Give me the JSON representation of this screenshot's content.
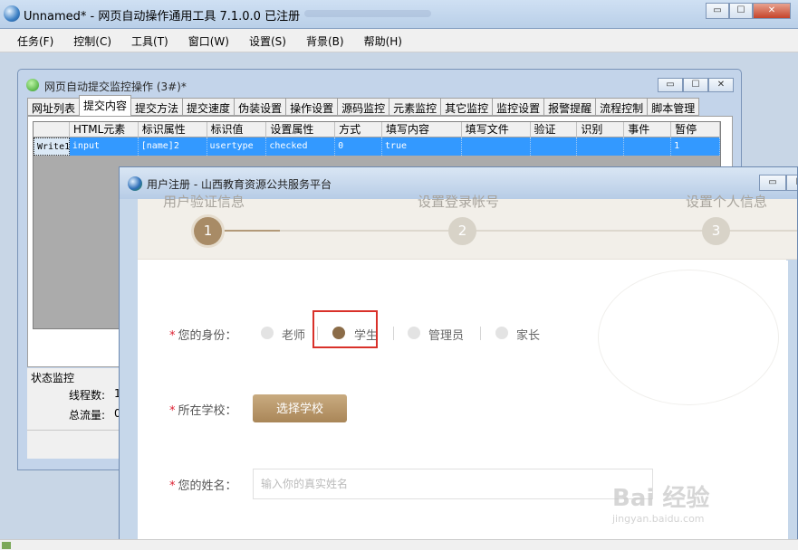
{
  "main_window": {
    "title": "Unnamed* - 网页自动操作通用工具 7.1.0.0  已注册",
    "buttons": [
      "▭",
      "☐",
      "✕"
    ]
  },
  "menu": [
    "任务(F)",
    "控制(C)",
    "工具(T)",
    "窗口(W)",
    "设置(S)",
    "背景(B)",
    "帮助(H)"
  ],
  "monitor_window": {
    "title": "网页自动提交监控操作  (3#)*",
    "buttons": [
      "▭",
      "☐",
      "✕"
    ],
    "tabs": [
      "网址列表",
      "提交内容",
      "提交方法",
      "提交速度",
      "伪装设置",
      "操作设置",
      "源码监控",
      "元素监控",
      "其它监控",
      "监控设置",
      "报警提醒",
      "流程控制",
      "脚本管理"
    ],
    "active_tab": "提交内容",
    "grid_headers": [
      "",
      "HTML元素",
      "标识属性",
      "标识值",
      "设置属性",
      "方式",
      "填写内容",
      "填写文件",
      "验证",
      "识别",
      "事件",
      "暂停"
    ],
    "grid_rows": [
      [
        "Write1",
        "input",
        "[name]2",
        "usertype",
        "checked",
        "0",
        "true",
        "",
        "",
        "",
        "",
        "1"
      ]
    ],
    "status": {
      "title": "状态监控",
      "thread_label": "线程数:",
      "thread_value": "1",
      "traffic_label": "总流量:",
      "traffic_value": "0"
    }
  },
  "register_window": {
    "title": "用户注册 - 山西教育资源公共服务平台",
    "buttons": [
      "▭",
      "☐"
    ],
    "steps": [
      {
        "label": "用户验证信息",
        "number": "1"
      },
      {
        "label": "设置登录帐号",
        "number": "2"
      },
      {
        "label": "设置个人信息",
        "number": "3"
      }
    ],
    "identity_label": "您的身份：",
    "identity_options": [
      "老师",
      "学生",
      "管理员",
      "家长"
    ],
    "identity_selected": "学生",
    "school_label": "所在学校：",
    "school_button": "选择学校",
    "name_label": "您的姓名：",
    "name_placeholder": "输入你的真实姓名",
    "required_mark": "*"
  },
  "watermark": {
    "text": "Bai 经验",
    "sub": "jingyan.baidu.com"
  }
}
